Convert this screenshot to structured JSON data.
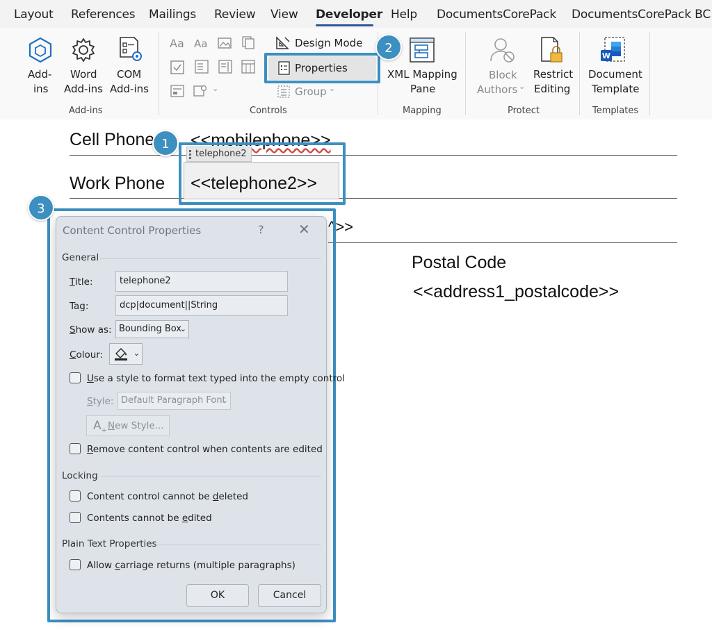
{
  "tabs": [
    {
      "label": "Layout",
      "active": false
    },
    {
      "label": "References",
      "active": false
    },
    {
      "label": "Mailings",
      "active": false
    },
    {
      "label": "Review",
      "active": false
    },
    {
      "label": "View",
      "active": false
    },
    {
      "label": "Developer",
      "active": true
    },
    {
      "label": "Help",
      "active": false
    },
    {
      "label": "DocumentsCorePack",
      "active": false
    },
    {
      "label": "DocumentsCorePack BC",
      "active": false
    }
  ],
  "ribbon": {
    "addins": {
      "group_label": "Add-ins",
      "addins_label_1": "Add-",
      "addins_label_2": "ins",
      "word_addins_1": "Word",
      "word_addins_2": "Add-ins",
      "com_addins_1": "COM",
      "com_addins_2": "Add-ins"
    },
    "controls": {
      "group_label": "Controls",
      "design_mode": "Design Mode",
      "properties": "Properties",
      "group": "Group",
      "aa_1": "Aa",
      "aa_2": "Aa"
    },
    "mapping": {
      "group_label": "Mapping",
      "xml_1": "XML Mapping",
      "xml_2": "Pane"
    },
    "protect": {
      "group_label": "Protect",
      "block_1": "Block",
      "block_2": "Authors",
      "restrict_1": "Restrict",
      "restrict_2": "Editing"
    },
    "templates": {
      "group_label": "Templates",
      "doc_1": "Document",
      "doc_2": "Template"
    }
  },
  "badges": [
    "1",
    "2",
    "3"
  ],
  "document": {
    "cell_phone_label": "Cell Phone",
    "cell_phone_value": "<<mobilephone>>",
    "cc_tag": "telephone2",
    "work_phone_label": "Work Phone",
    "work_phone_value": "<<telephone2>>",
    "hidden_fragment": "^>>",
    "postal_label": "Postal Code",
    "postal_value": "<<address1_postalcode>>"
  },
  "dialog": {
    "title": "Content Control Properties",
    "help": "?",
    "close": "✕",
    "general_header": "General",
    "title_label_u": "T",
    "title_label_rest": "itle:",
    "title_value": "telephone2",
    "tag_label_a": "Ta",
    "tag_label_u": "g",
    "tag_label_rest": ":",
    "tag_value": "dcp|document||String",
    "show_as_label_u": "S",
    "show_as_label_rest": "how as:",
    "show_as_value": "Bounding Box",
    "colour_label_u": "C",
    "colour_label_rest": "olour:",
    "use_style_u": "U",
    "use_style_rest": "se a style to format text typed into the empty control",
    "style_label_u": "S",
    "style_label_rest": "tyle:",
    "style_value": "Default Paragraph Font",
    "new_style_u": "N",
    "new_style_rest": "ew Style...",
    "remove_cc_u": "R",
    "remove_cc_rest": "emove content control when contents are edited",
    "locking_header": "Locking",
    "cannot_delete_a": "Content control cannot be ",
    "cannot_delete_u": "d",
    "cannot_delete_rest": "eleted",
    "cannot_edit_a": "Contents cannot be ",
    "cannot_edit_u": "e",
    "cannot_edit_rest": "dited",
    "plain_text_header": "Plain Text Properties",
    "allow_cr_a": "Allow ",
    "allow_cr_u": "c",
    "allow_cr_rest": "arriage returns (multiple paragraphs)",
    "ok": "OK",
    "cancel": "Cancel",
    "checkboxes": {
      "use_style": false,
      "remove_cc": false,
      "cannot_delete": false,
      "cannot_edit": false,
      "allow_cr": false
    }
  },
  "colors": {
    "accent": "#3d8fc0",
    "tab_active_underline": "#2b579a"
  }
}
